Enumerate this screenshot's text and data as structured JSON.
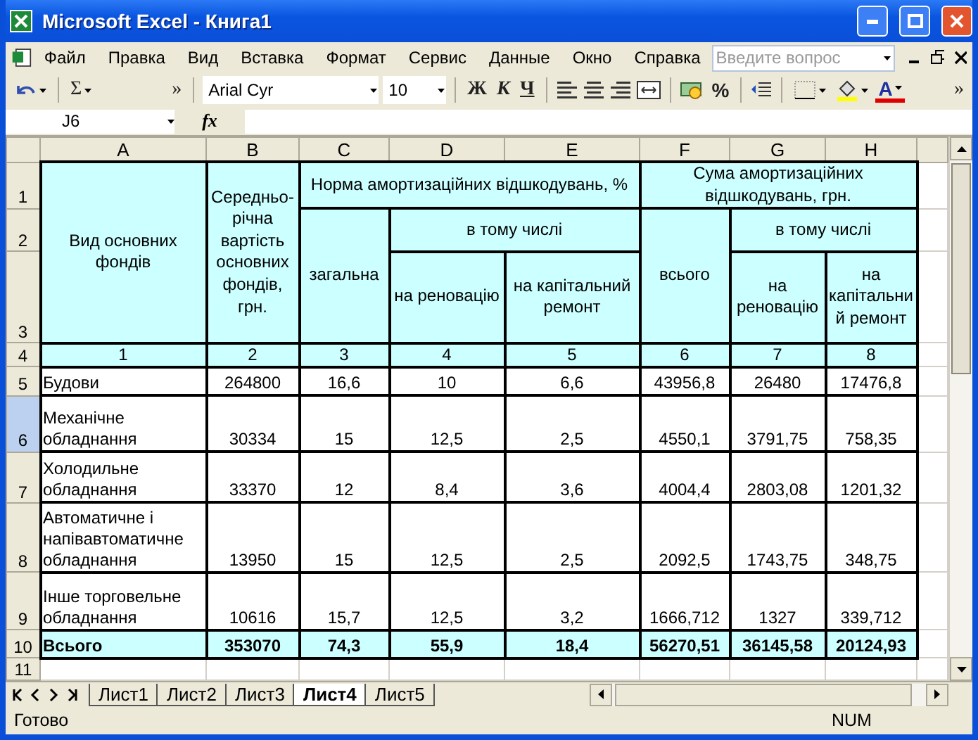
{
  "window": {
    "title": "Microsoft Excel - Книга1"
  },
  "menu": {
    "items": [
      "Файл",
      "Правка",
      "Вид",
      "Вставка",
      "Формат",
      "Сервис",
      "Данные",
      "Окно",
      "Справка"
    ],
    "help_placeholder": "Введите вопрос"
  },
  "toolbar": [
    {
      "kind": "undo"
    },
    {
      "kind": "sep"
    },
    {
      "kind": "sum",
      "label": "Σ"
    },
    {
      "kind": "chevron",
      "label": "»"
    },
    {
      "kind": "sep"
    },
    {
      "kind": "font",
      "label": "Arial Cyr"
    },
    {
      "kind": "size",
      "label": "10"
    },
    {
      "kind": "sep"
    },
    {
      "kind": "bold",
      "label": "Ж"
    },
    {
      "kind": "italic",
      "label": "К"
    },
    {
      "kind": "underline",
      "label": "Ч"
    },
    {
      "kind": "sep"
    },
    {
      "kind": "align-left"
    },
    {
      "kind": "align-center"
    },
    {
      "kind": "align-right"
    },
    {
      "kind": "merge"
    },
    {
      "kind": "sep"
    },
    {
      "kind": "currency"
    },
    {
      "kind": "percent",
      "label": "%"
    },
    {
      "kind": "sep"
    },
    {
      "kind": "indent"
    },
    {
      "kind": "sep"
    },
    {
      "kind": "borders"
    },
    {
      "kind": "fill"
    },
    {
      "kind": "font-color",
      "label": "A"
    },
    {
      "kind": "chevron",
      "label": "»"
    }
  ],
  "formula_bar": {
    "name_box": "J6",
    "function_label": "fx"
  },
  "columns": [
    "A",
    "B",
    "C",
    "D",
    "E",
    "F",
    "G",
    "H"
  ],
  "header_rows": [
    {
      "number": "1",
      "selected": false,
      "cells": [
        {
          "text": "Вид основних фондів",
          "rowspan": 3
        },
        {
          "text": "Середньо-річна вартість основних фондів, грн.",
          "rowspan": 3
        },
        {
          "text": "Норма амортизаційних відшкодувань, %",
          "colspan": 3
        },
        {
          "text": "Сума амортизаційних відшкодувань, грн.",
          "colspan": 3
        }
      ]
    },
    {
      "number": "2",
      "selected": false,
      "cells": [
        {
          "text": "загальна",
          "rowspan": 2
        },
        {
          "text": "в тому числі",
          "colspan": 2
        },
        {
          "text": "всього",
          "rowspan": 2
        },
        {
          "text": "в тому числі",
          "colspan": 2
        }
      ]
    },
    {
      "number": "3",
      "selected": false,
      "cells": [
        {
          "text": "на реновацію"
        },
        {
          "text": "на капітальний ремонт"
        },
        {
          "text": "на реновацію"
        },
        {
          "text": "на капітальний ремонт"
        }
      ]
    }
  ],
  "rows": [
    {
      "number": "4",
      "kind": "index",
      "selected": false,
      "cells": [
        "1",
        "2",
        "3",
        "4",
        "5",
        "6",
        "7",
        "8"
      ]
    },
    {
      "number": "5",
      "kind": "data",
      "selected": false,
      "cells": [
        "Будови",
        "264800",
        "16,6",
        "10",
        "6,6",
        "43956,8",
        "26480",
        "17476,8"
      ]
    },
    {
      "number": "6",
      "kind": "data",
      "selected": true,
      "cells": [
        "Механічне обладнання",
        "30334",
        "15",
        "12,5",
        "2,5",
        "4550,1",
        "3791,75",
        "758,35"
      ]
    },
    {
      "number": "7",
      "kind": "data",
      "selected": false,
      "cells": [
        "Холодильне обладнання",
        "33370",
        "12",
        "8,4",
        "3,6",
        "4004,4",
        "2803,08",
        "1201,32"
      ]
    },
    {
      "number": "8",
      "kind": "data",
      "selected": false,
      "cells": [
        "Автоматичне і напівавтоматичне обладнання",
        "13950",
        "15",
        "12,5",
        "2,5",
        "2092,5",
        "1743,75",
        "348,75"
      ]
    },
    {
      "number": "9",
      "kind": "data",
      "selected": false,
      "cells": [
        "Інше торговельне обладнання",
        "10616",
        "15,7",
        "12,5",
        "3,2",
        "1666,712",
        "1327",
        "339,712"
      ]
    },
    {
      "number": "10",
      "kind": "total",
      "selected": false,
      "cells": [
        "Всього",
        "353070",
        "74,3",
        "55,9",
        "18,4",
        "56270,51",
        "36145,58",
        "20124,93"
      ]
    },
    {
      "number": "11",
      "kind": "blank",
      "selected": false
    }
  ],
  "sheet_tabs": [
    {
      "label": "Лист1",
      "selected": false
    },
    {
      "label": "Лист2",
      "selected": false
    },
    {
      "label": "Лист3",
      "selected": false
    },
    {
      "label": "Лист4",
      "selected": true
    },
    {
      "label": "Лист5",
      "selected": false
    }
  ],
  "status_bar": {
    "text": "Готово",
    "indicator": "NUM"
  }
}
